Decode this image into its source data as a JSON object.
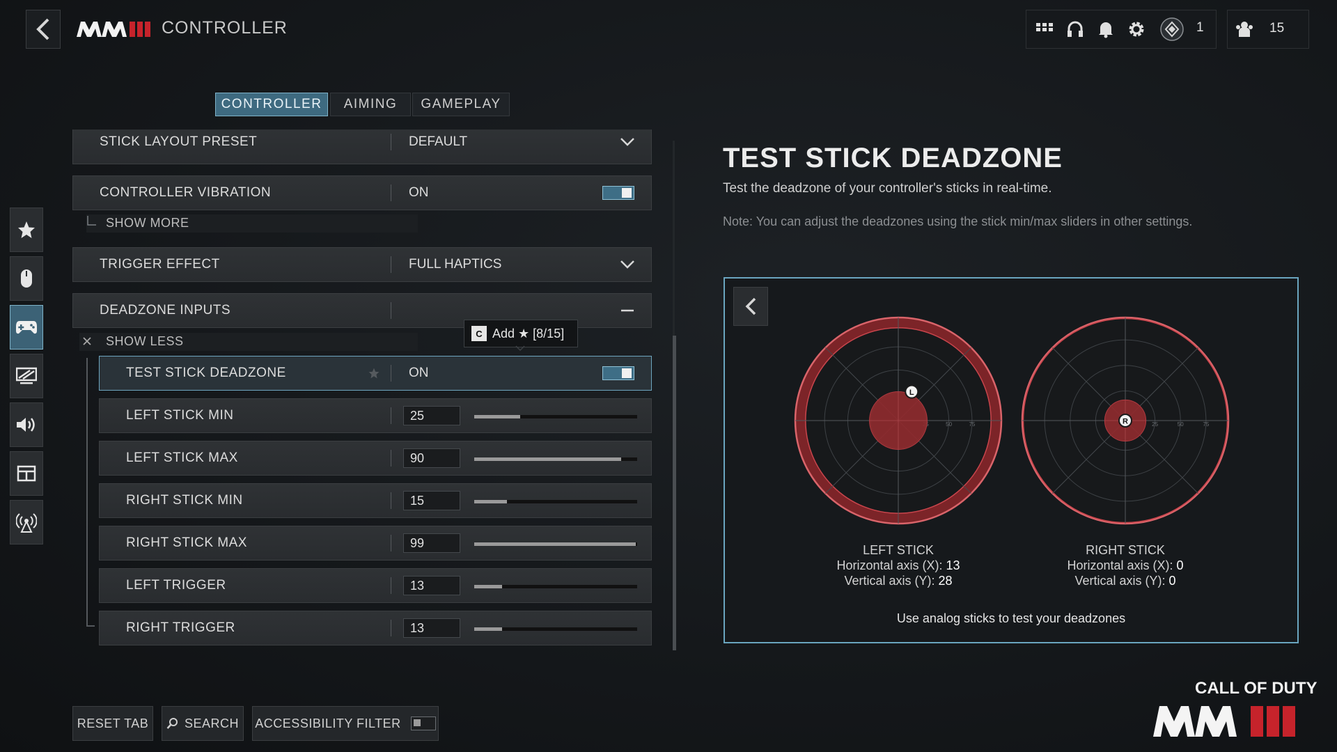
{
  "header": {
    "title": "CONTROLLER",
    "logo_text": "MWIII",
    "notifications_count": "1",
    "party_count": "15"
  },
  "tabs": [
    {
      "label": "CONTROLLER",
      "active": true
    },
    {
      "label": "AIMING",
      "active": false
    },
    {
      "label": "GAMEPLAY",
      "active": false
    }
  ],
  "sidebar": {
    "items": [
      {
        "icon": "star-icon",
        "active": false
      },
      {
        "icon": "mouse-icon",
        "active": false
      },
      {
        "icon": "gamepad-icon",
        "active": true
      },
      {
        "icon": "display-icon",
        "active": false
      },
      {
        "icon": "speaker-icon",
        "active": false
      },
      {
        "icon": "interface-icon",
        "active": false
      },
      {
        "icon": "network-icon",
        "active": false
      }
    ]
  },
  "settings": {
    "stick_layout": {
      "label": "STICK LAYOUT PRESET",
      "value": "DEFAULT"
    },
    "vibration": {
      "label": "CONTROLLER VIBRATION",
      "value": "ON"
    },
    "show_more": "SHOW MORE",
    "trigger_effect": {
      "label": "TRIGGER EFFECT",
      "value": "FULL HAPTICS"
    },
    "deadzone_inputs": {
      "label": "DEADZONE INPUTS"
    },
    "show_less": "SHOW LESS",
    "test_stick": {
      "label": "TEST STICK DEADZONE",
      "value": "ON"
    },
    "sliders": [
      {
        "label": "LEFT STICK MIN",
        "value": "25",
        "fraction": 0.28
      },
      {
        "label": "LEFT STICK MAX",
        "value": "90",
        "fraction": 0.9
      },
      {
        "label": "RIGHT STICK MIN",
        "value": "15",
        "fraction": 0.2
      },
      {
        "label": "RIGHT STICK MAX",
        "value": "99",
        "fraction": 0.99
      },
      {
        "label": "LEFT TRIGGER",
        "value": "13",
        "fraction": 0.17
      },
      {
        "label": "RIGHT TRIGGER",
        "value": "13",
        "fraction": 0.17
      }
    ]
  },
  "tooltip": {
    "key": "C",
    "text": "Add ★ [8/15]"
  },
  "test_panel": {
    "title": "TEST STICK DEADZONE",
    "description": "Test the deadzone of your controller's sticks in real-time.",
    "note": "Note: You can adjust the deadzones using the stick min/max sliders in other settings.",
    "left_stick": {
      "name": "LEFT STICK",
      "h_label": "Horizontal axis (X):",
      "h_value": "13",
      "v_label": "Vertical axis (Y):",
      "v_value": "28",
      "marker": "L"
    },
    "right_stick": {
      "name": "RIGHT STICK",
      "h_label": "Horizontal axis (X):",
      "h_value": "0",
      "v_label": "Vertical axis (Y):",
      "v_value": "0",
      "marker": "R"
    },
    "ring_labels": [
      "25",
      "50",
      "75"
    ],
    "footer": "Use analog sticks to test your deadzones"
  },
  "bottom": {
    "reset": "RESET TAB",
    "search": "SEARCH",
    "accessibility": "ACCESSIBILITY FILTER"
  },
  "brand": {
    "line1": "CALL OF DUTY",
    "line2": "MWIII"
  },
  "colors": {
    "accent": "#6aa5bf",
    "deadzone": "#8e2a2e",
    "ring": "#c9454c"
  }
}
